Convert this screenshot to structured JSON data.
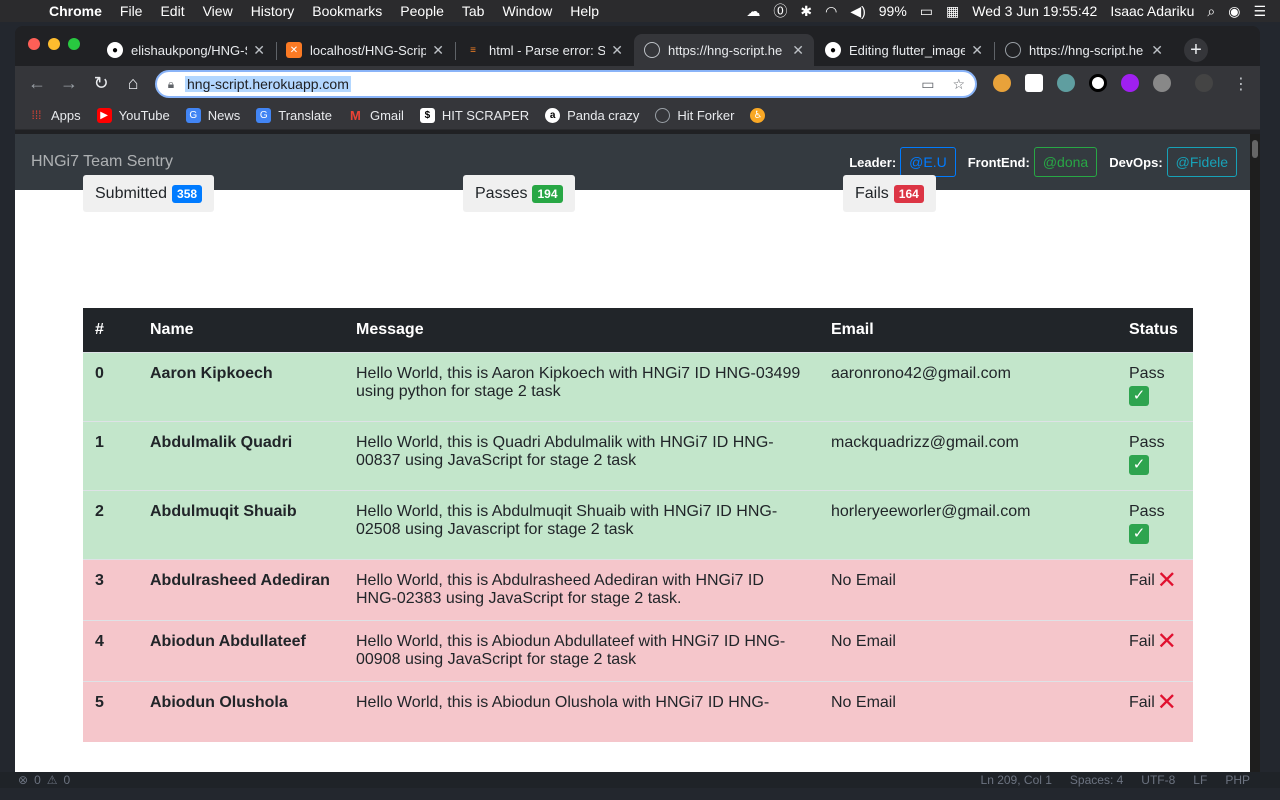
{
  "menubar": {
    "app": "Chrome",
    "items": [
      "File",
      "Edit",
      "View",
      "History",
      "Bookmarks",
      "People",
      "Tab",
      "Window",
      "Help"
    ],
    "battery": "99%",
    "clock": "Wed 3 Jun  19:55:42",
    "user": "Isaac Adariku"
  },
  "browser": {
    "tabs": [
      {
        "title": "elishaukpong/HNG-S",
        "icon": "github-icon"
      },
      {
        "title": "localhost/HNG-Scrip",
        "icon": "xampp-icon"
      },
      {
        "title": "html - Parse error: S",
        "icon": "stackoverflow-icon"
      },
      {
        "title": "https://hng-script.he",
        "icon": "globe-icon"
      },
      {
        "title": "Editing flutter_image",
        "icon": "github-icon"
      },
      {
        "title": "https://hng-script.he",
        "icon": "globe-icon"
      }
    ],
    "url": "hng-script.herokuapp.com",
    "bookmarks": [
      {
        "label": "Apps",
        "icon": "apps-grid-icon"
      },
      {
        "label": "YouTube",
        "icon": "youtube-icon"
      },
      {
        "label": "News",
        "icon": "news-icon"
      },
      {
        "label": "Translate",
        "icon": "translate-icon"
      },
      {
        "label": "Gmail",
        "icon": "gmail-icon"
      },
      {
        "label": "HIT SCRAPER",
        "icon": "hit-scraper-icon"
      },
      {
        "label": "Panda crazy",
        "icon": "amazon-icon"
      },
      {
        "label": "Hit Forker",
        "icon": "globe-icon"
      },
      {
        "label": "",
        "icon": "accessibility-icon"
      }
    ]
  },
  "navbar": {
    "brand": "HNGi7 Team Sentry",
    "leader_label": "Leader:",
    "leader": "@E.U",
    "frontend_label": "FrontEnd:",
    "frontend": "@dona",
    "devops_label": "DevOps:",
    "devops": "@Fidele"
  },
  "stats": {
    "submitted_label": "Submitted",
    "submitted": "358",
    "passes_label": "Passes",
    "passes": "194",
    "fails_label": "Fails",
    "fails": "164"
  },
  "table": {
    "headers": [
      "#",
      "Name",
      "Message",
      "Email",
      "Status"
    ],
    "rows": [
      {
        "num": "0",
        "name": "Aaron Kipkoech",
        "message": "Hello World, this is Aaron Kipkoech with HNGi7 ID HNG-03499 using python for stage 2 task",
        "email": "aaronrono42@gmail.com",
        "status": "Pass"
      },
      {
        "num": "1",
        "name": "Abdulmalik Quadri",
        "message": "Hello World, this is Quadri Abdulmalik with HNGi7 ID HNG-00837 using JavaScript for stage 2 task",
        "email": "mackquadrizz@gmail.com",
        "status": "Pass"
      },
      {
        "num": "2",
        "name": "Abdulmuqit Shuaib",
        "message": "Hello World, this is Abdulmuqit Shuaib with HNGi7 ID HNG-02508 using Javascript for stage 2 task",
        "email": "horleryeeworler@gmail.com",
        "status": "Pass"
      },
      {
        "num": "3",
        "name": "Abdulrasheed Adediran",
        "message": "Hello World, this is Abdulrasheed Adediran with HNGi7 ID HNG-02383 using JavaScript for stage 2 task.",
        "email": "No Email",
        "status": "Fail"
      },
      {
        "num": "4",
        "name": "Abiodun Abdullateef",
        "message": "Hello World, this is Abiodun Abdullateef with HNGi7 ID HNG-00908 using JavaScript for stage 2 task",
        "email": "No Email",
        "status": "Fail"
      },
      {
        "num": "5",
        "name": "Abiodun Olushola",
        "message": "Hello World, this is Abiodun Olushola with HNGi7 ID HNG-",
        "email": "No Email",
        "status": "Fail"
      }
    ]
  },
  "statusbar": {
    "problems": "0",
    "warnings": "0",
    "position": "Ln 209, Col 1",
    "spaces": "Spaces: 4",
    "encoding": "UTF-8",
    "eol": "LF",
    "language": "PHP"
  },
  "colors": {
    "pass_row": "#c3e6cb",
    "fail_row": "#f5c6cb",
    "navbar": "#343a40"
  }
}
